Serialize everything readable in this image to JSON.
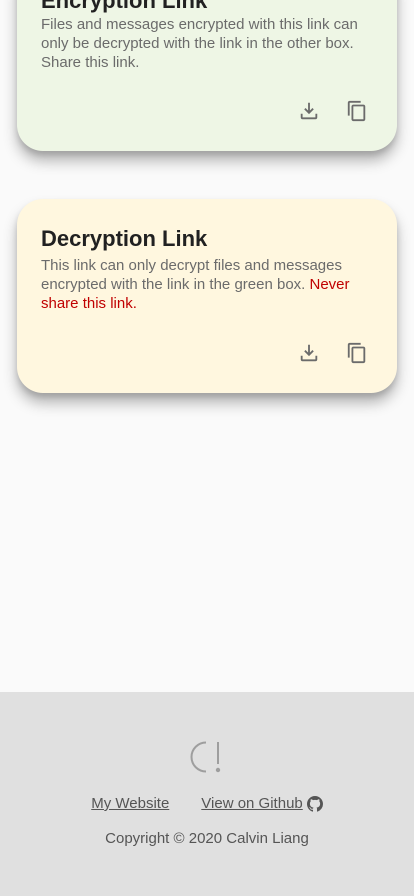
{
  "encryption_card": {
    "title": "Encryption Link",
    "description": "Files and messages encrypted with this link can only be decrypted with the link in the other box. Share this link.",
    "background": "#eef6e5",
    "actions": [
      "download-icon",
      "copy-icon"
    ]
  },
  "decryption_card": {
    "title": "Decryption Link",
    "description": "This link can only decrypt files and messages encrypted with the link in the green box.",
    "warning": "Never share this link.",
    "warning_color": "#c00000",
    "background": "#fff7df",
    "actions": [
      "download-icon",
      "copy-icon"
    ]
  },
  "footer": {
    "logo": "app-logo-icon",
    "links": [
      {
        "label": "My Website"
      },
      {
        "label": "View on Github",
        "icon": "github-icon"
      }
    ],
    "copyright": "Copyright © 2020 Calvin Liang"
  }
}
